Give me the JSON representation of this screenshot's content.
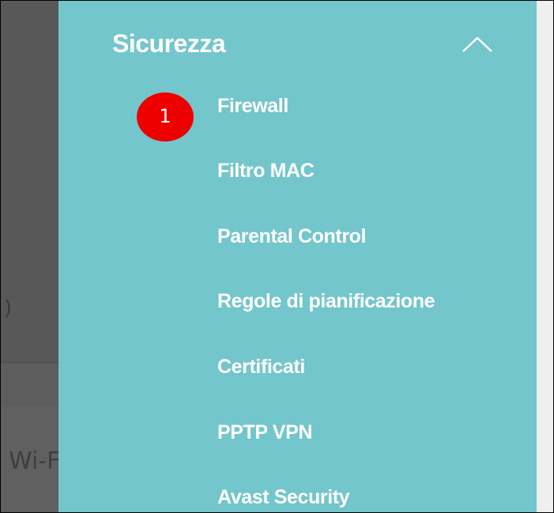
{
  "background_page": {
    "left_paren": ")",
    "partial_label": "Wi-F"
  },
  "menu": {
    "section_title": "Sicurezza",
    "collapse_icon": "chevron-up-icon",
    "items": [
      {
        "label": "Firewall"
      },
      {
        "label": "Filtro MAC"
      },
      {
        "label": "Parental Control"
      },
      {
        "label": "Regole di pianificazione"
      },
      {
        "label": "Certificati"
      },
      {
        "label": "PPTP VPN"
      },
      {
        "label": "Avast Security"
      }
    ]
  },
  "annotation": {
    "step_number": "1",
    "color": "#ee0000"
  },
  "colors": {
    "panel": "#73c6cb",
    "text": "#ffffff"
  }
}
